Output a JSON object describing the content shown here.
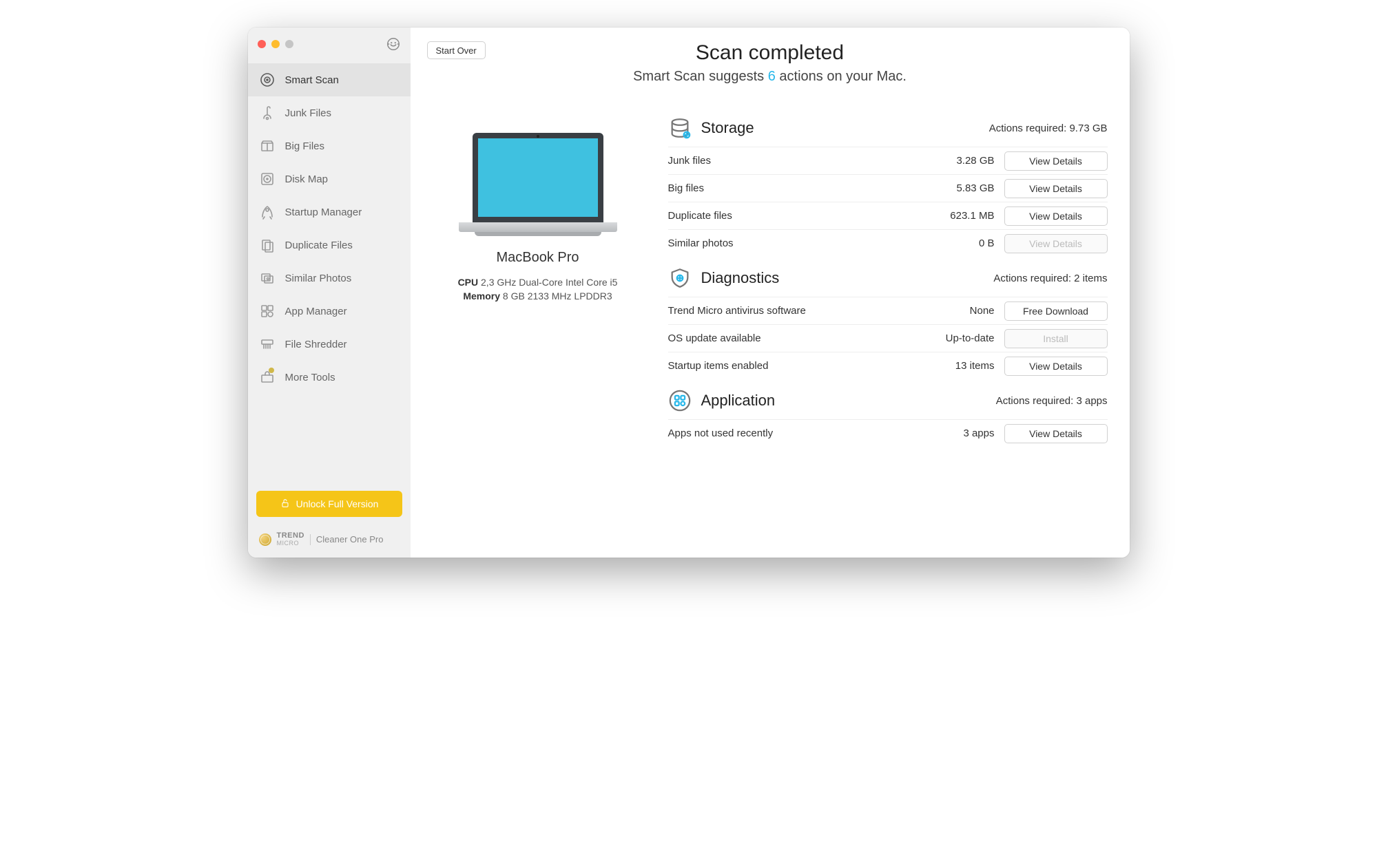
{
  "header": {
    "start_over": "Start Over",
    "title": "Scan completed",
    "subtitle_pre": "Smart Scan suggests ",
    "subtitle_count": "6",
    "subtitle_post": " actions on your Mac."
  },
  "sidebar": {
    "items": [
      {
        "label": "Smart Scan"
      },
      {
        "label": "Junk Files"
      },
      {
        "label": "Big Files"
      },
      {
        "label": "Disk Map"
      },
      {
        "label": "Startup Manager"
      },
      {
        "label": "Duplicate Files"
      },
      {
        "label": "Similar Photos"
      },
      {
        "label": "App Manager"
      },
      {
        "label": "File Shredder"
      },
      {
        "label": "More Tools"
      }
    ],
    "unlock": "Unlock Full Version",
    "brand_top": "TREND",
    "brand_bottom": "MICRO",
    "product": "Cleaner One Pro"
  },
  "device": {
    "name": "MacBook Pro",
    "cpu_label": "CPU",
    "cpu": "2,3 GHz Dual-Core Intel Core i5",
    "mem_label": "Memory",
    "mem": "8 GB 2133 MHz LPDDR3"
  },
  "sections": {
    "storage": {
      "title": "Storage",
      "meta": "Actions required: 9.73 GB",
      "rows": [
        {
          "label": "Junk files",
          "value": "3.28 GB",
          "action": "View Details",
          "enabled": true
        },
        {
          "label": "Big files",
          "value": "5.83 GB",
          "action": "View Details",
          "enabled": true
        },
        {
          "label": "Duplicate files",
          "value": "623.1 MB",
          "action": "View Details",
          "enabled": true
        },
        {
          "label": "Similar photos",
          "value": "0 B",
          "action": "View Details",
          "enabled": false
        }
      ]
    },
    "diagnostics": {
      "title": "Diagnostics",
      "meta": "Actions required: 2 items",
      "rows": [
        {
          "label": "Trend Micro antivirus software",
          "value": "None",
          "action": "Free Download",
          "enabled": true
        },
        {
          "label": "OS update available",
          "value": "Up-to-date",
          "action": "Install",
          "enabled": false
        },
        {
          "label": "Startup items enabled",
          "value": "13 items",
          "action": "View Details",
          "enabled": true
        }
      ]
    },
    "application": {
      "title": "Application",
      "meta": "Actions required: 3 apps",
      "rows": [
        {
          "label": "Apps not used recently",
          "value": "3 apps",
          "action": "View Details",
          "enabled": true
        }
      ]
    }
  }
}
